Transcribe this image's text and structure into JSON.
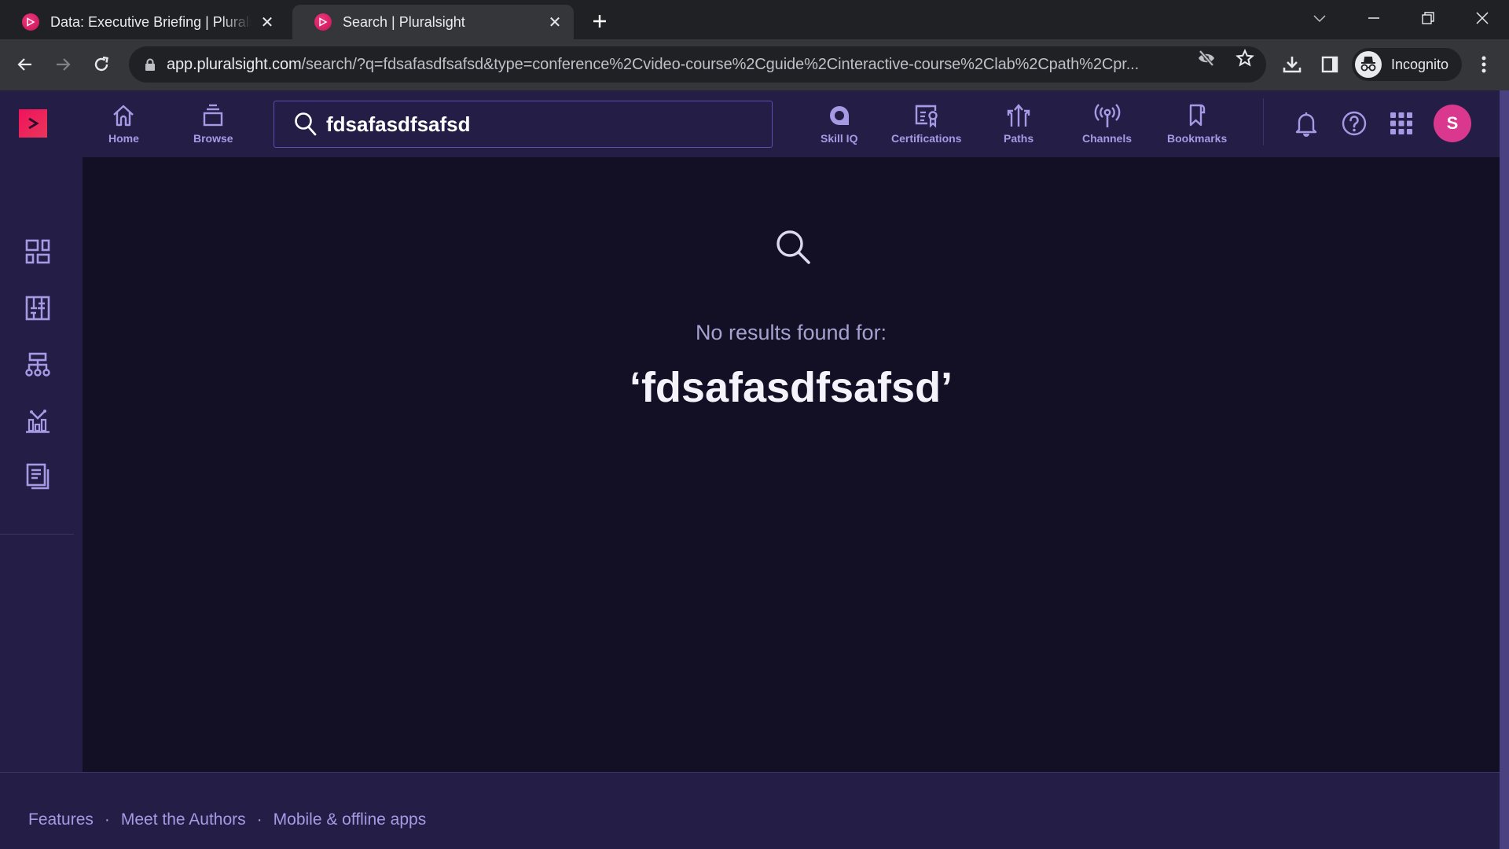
{
  "browser": {
    "tabs": [
      {
        "title": "Data: Executive Briefing | Pluralsight",
        "active": false
      },
      {
        "title": "Search | Pluralsight",
        "active": true
      }
    ],
    "url_host": "app.pluralsight.com",
    "url_path": "/search/?q=fdsafasdfsafsd&type=conference%2Cvideo-course%2Cguide%2Cinteractive-course%2Clab%2Cpath%2Cpr...",
    "profile_label": "Incognito"
  },
  "header": {
    "nav": [
      {
        "id": "home",
        "label": "Home"
      },
      {
        "id": "browse",
        "label": "Browse"
      },
      {
        "id": "skill-iq",
        "label": "Skill IQ"
      },
      {
        "id": "certifications",
        "label": "Certifications"
      },
      {
        "id": "paths",
        "label": "Paths"
      },
      {
        "id": "channels",
        "label": "Channels"
      },
      {
        "id": "bookmarks",
        "label": "Bookmarks"
      }
    ],
    "search_value": "fdsafasdfsafsd",
    "avatar_initial": "S"
  },
  "sidebar": {
    "items": [
      {
        "icon": "dashboard-icon"
      },
      {
        "icon": "layout-icon"
      },
      {
        "icon": "org-chart-icon"
      },
      {
        "icon": "analytics-icon"
      },
      {
        "icon": "reports-icon"
      }
    ]
  },
  "main": {
    "empty_message": "No results found for:",
    "query_display": "‘fdsafasdfsafsd’"
  },
  "footer": {
    "links": [
      "Features",
      "Meet the Authors",
      "Mobile & offline apps"
    ],
    "separator": "·"
  },
  "colors": {
    "brand": "#f0115c",
    "header_bg": "#241d46",
    "content_bg": "#130f25",
    "accent_text": "#a59ae3",
    "avatar": "#d9388e"
  }
}
